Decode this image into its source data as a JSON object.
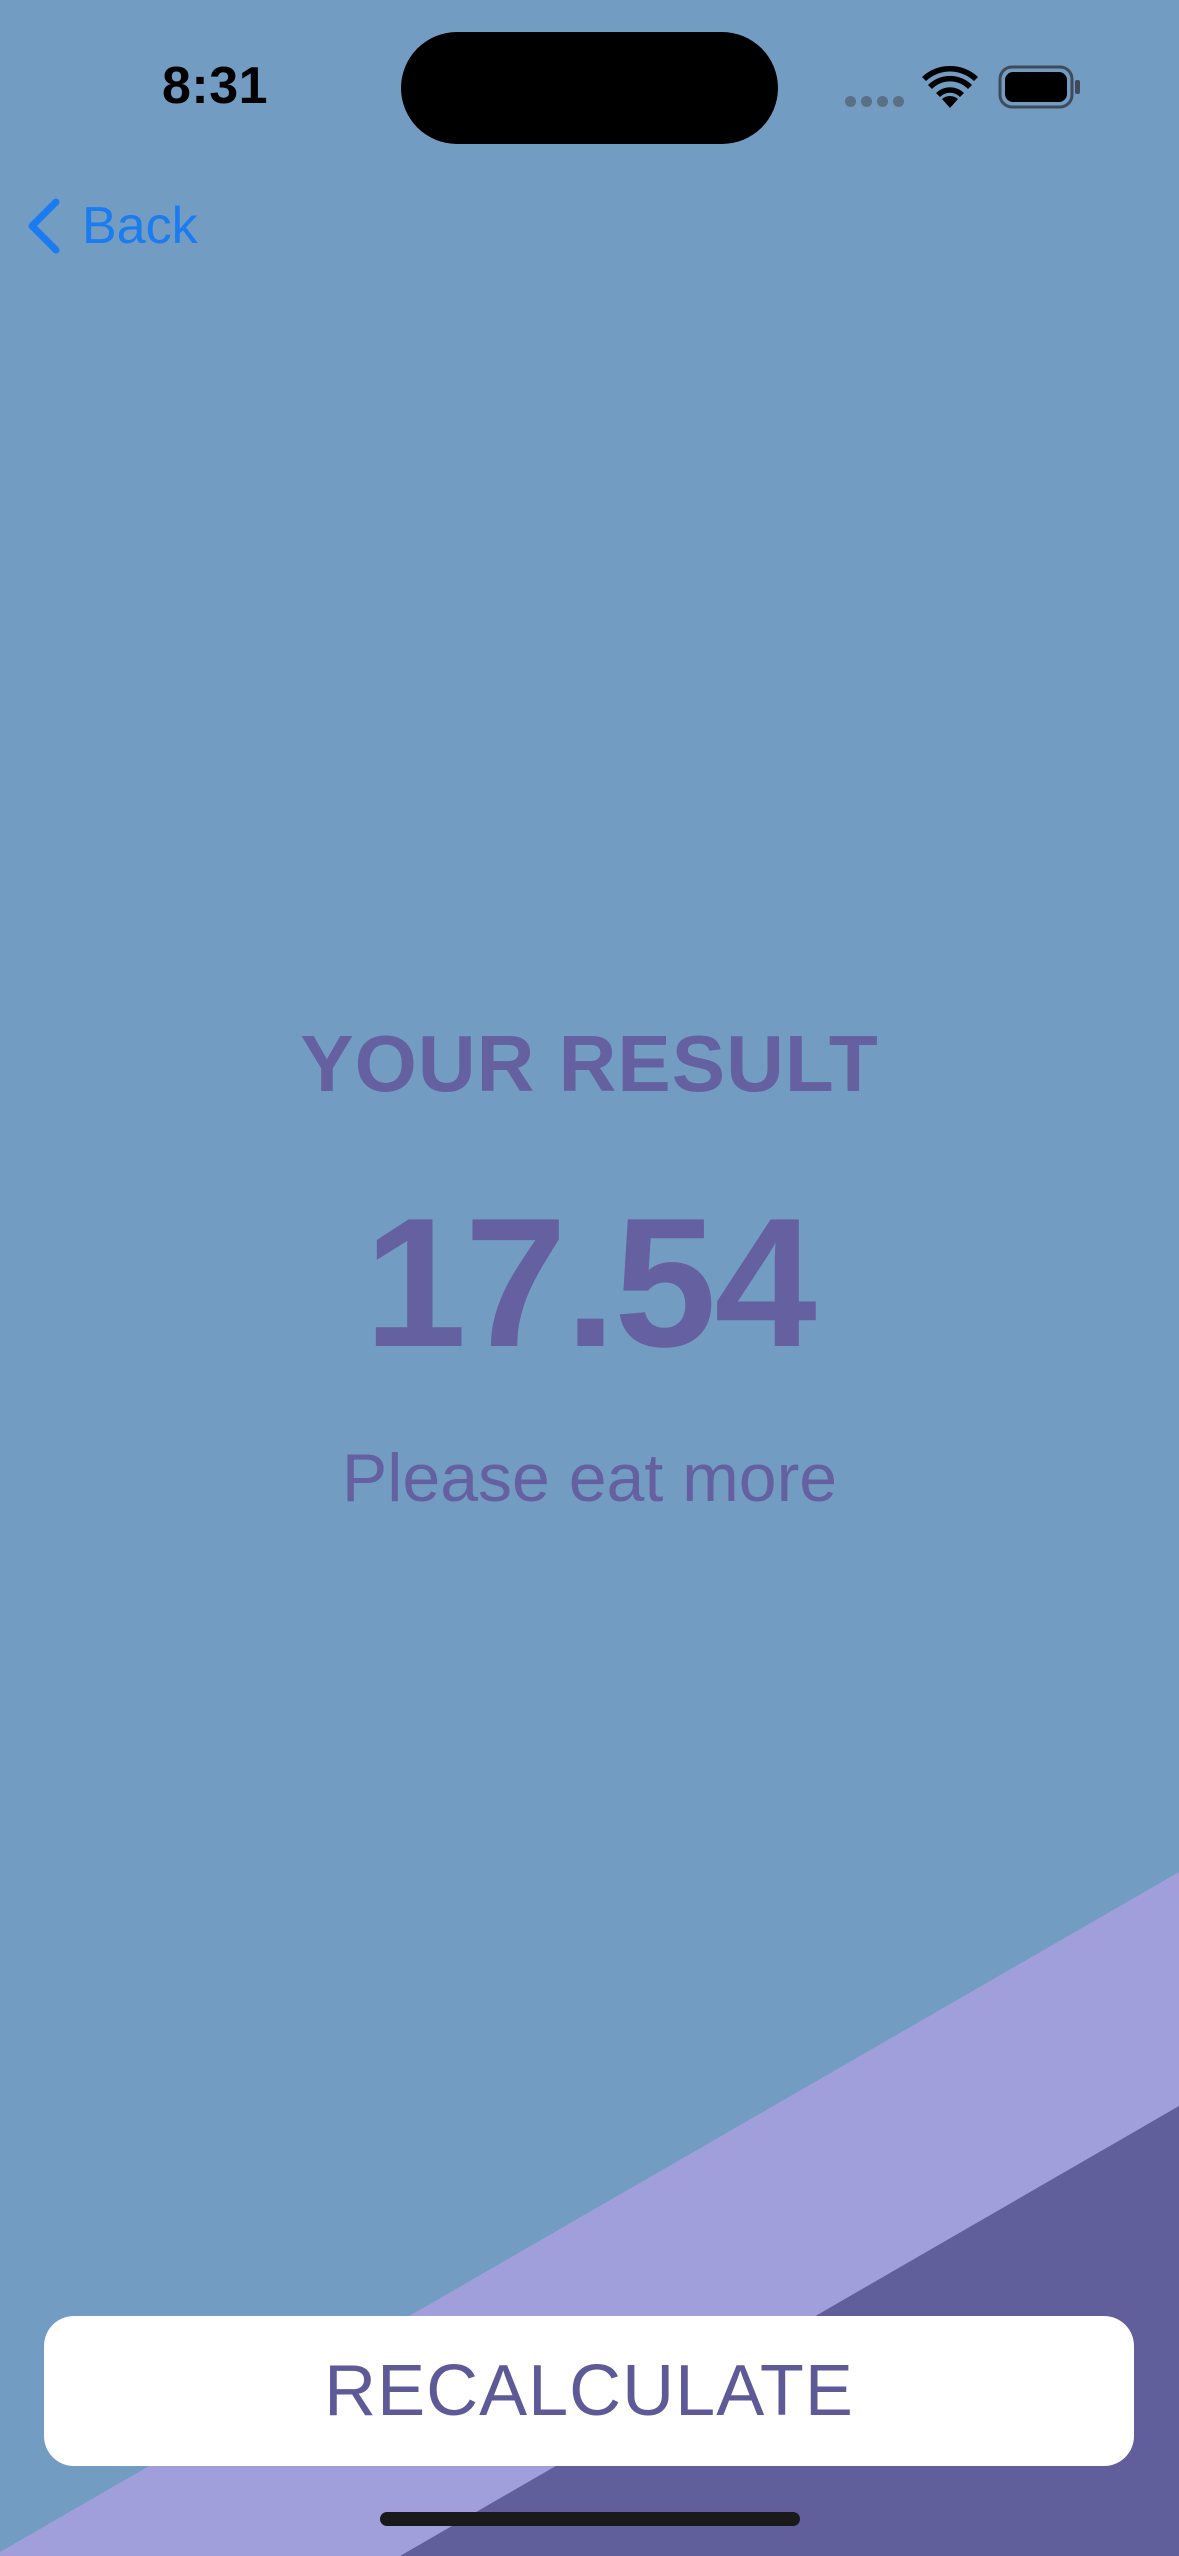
{
  "status_bar": {
    "time": "8:31"
  },
  "nav": {
    "back_label": "Back"
  },
  "result": {
    "title": "YOUR RESULT",
    "value": "17.54",
    "advice": "Please eat more"
  },
  "actions": {
    "recalculate_label": "RECALCULATE"
  },
  "theme": {
    "background": "#739cc2",
    "band_light": "#a09fdb",
    "band_dark": "#615f9b",
    "text_accent": "#65609f",
    "link_blue": "#1a7cf0"
  },
  "icons": {
    "back": "chevron-left-icon",
    "wifi": "wifi-icon",
    "battery": "battery-icon",
    "signal": "cellular-signal-icon"
  }
}
